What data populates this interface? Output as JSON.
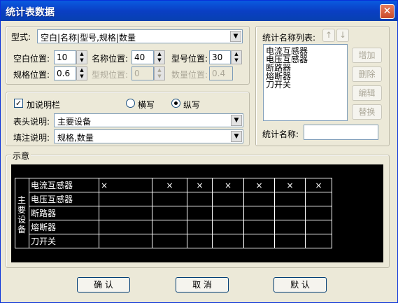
{
  "window": {
    "title": "统计表数据"
  },
  "type": {
    "label": "型式:",
    "value": "空白|名称|型号,规格|数量"
  },
  "positions": {
    "blank_label": "空白位置:",
    "blank_value": "10",
    "name_label": "名称位置:",
    "name_value": "40",
    "model_label": "型号位置:",
    "model_value": "30",
    "spec_label": "规格位置:",
    "spec_value": "0.6",
    "modelspec_label": "型规位置:",
    "modelspec_value": "0",
    "qty_label": "数量位置:",
    "qty_value": "0.4"
  },
  "notes": {
    "add_note_label": "加说明栏",
    "add_note_checked": true,
    "horizontal_label": "横写",
    "vertical_label": "纵写",
    "selected": "vertical",
    "header_label": "表头说明:",
    "header_value": "主要设备",
    "fill_label": "填注说明:",
    "fill_value": "规格,数量"
  },
  "stats": {
    "list_label": "统计名称列表:",
    "up_arrow": "↑",
    "down_arrow": "↓",
    "items": [
      "电流互感器",
      "电压互感器",
      "断路器",
      "熔断器",
      "刀开关"
    ],
    "add": "增加",
    "delete": "删除",
    "edit": "编辑",
    "replace": "替换",
    "name_label": "统计名称:",
    "name_value": ""
  },
  "preview": {
    "label": "示意",
    "header_chars": [
      "主",
      "要",
      "设",
      "备"
    ],
    "rows": [
      "电流互感器",
      "电压互感器",
      "断路器",
      "熔断器",
      "刀开关"
    ],
    "mark": "×"
  },
  "buttons": {
    "ok": "确 认",
    "cancel": "取 消",
    "default": "默 认"
  }
}
